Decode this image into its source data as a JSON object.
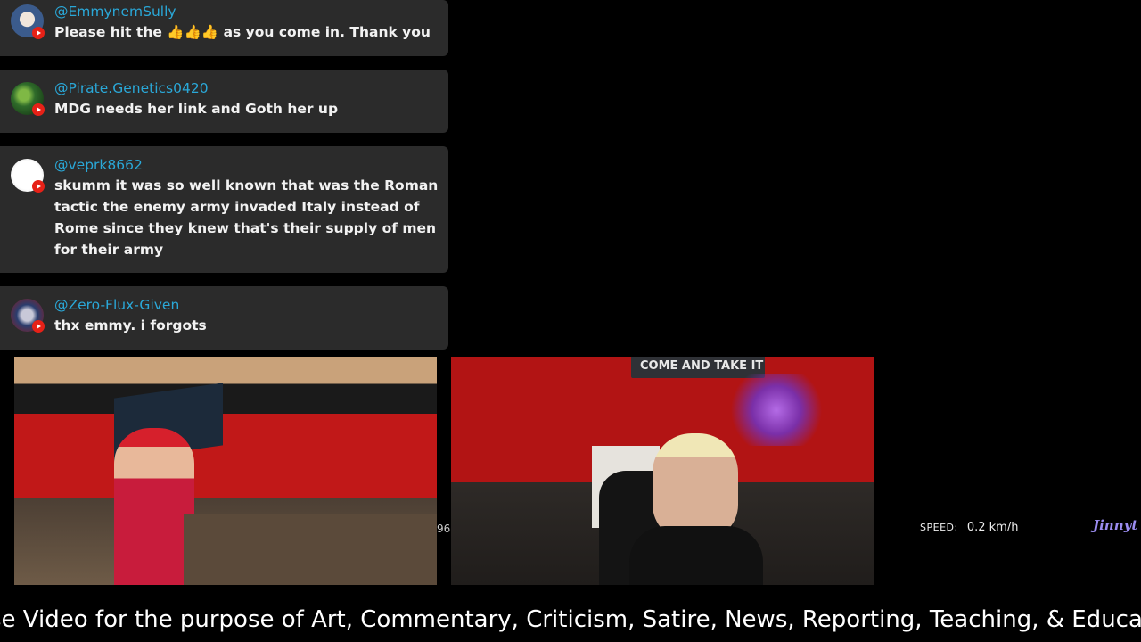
{
  "chat": [
    {
      "username": "@EmmynemSully",
      "message": "Please hit the 👍👍👍 as you come in. Thank you",
      "avatar_color": "#3b5b8c"
    },
    {
      "username": "@Pirate.Genetics0420",
      "message": "MDG needs her link and Goth her up",
      "avatar_color": "#2f6b2a"
    },
    {
      "username": "@veprk8662",
      "message": "skumm it was so well known that was the Roman tactic the enemy army invaded Italy instead of Rome since they knew that's their supply of men for their army",
      "avatar_color": "#e8e8e8"
    },
    {
      "username": "@Zero-Flux-Given",
      "message": "thx emmy. i forgots",
      "avatar_color": "#2a3d6e"
    }
  ],
  "overlay": {
    "speed_label": "SPEED:",
    "speed_value": "0.2 km/h",
    "brand_text": "Jinnyt",
    "partial_number": "96",
    "camera2_banner": "COME AND TAKE IT"
  },
  "ticker": {
    "text": "se Video for the purpose of Art, Commentary, Criticism, Satire, News, Reporting, Teaching, & Educat"
  },
  "colors": {
    "username": "#2aa8d8",
    "card": "#2b2b2b",
    "youtube_badge": "#e62117"
  }
}
